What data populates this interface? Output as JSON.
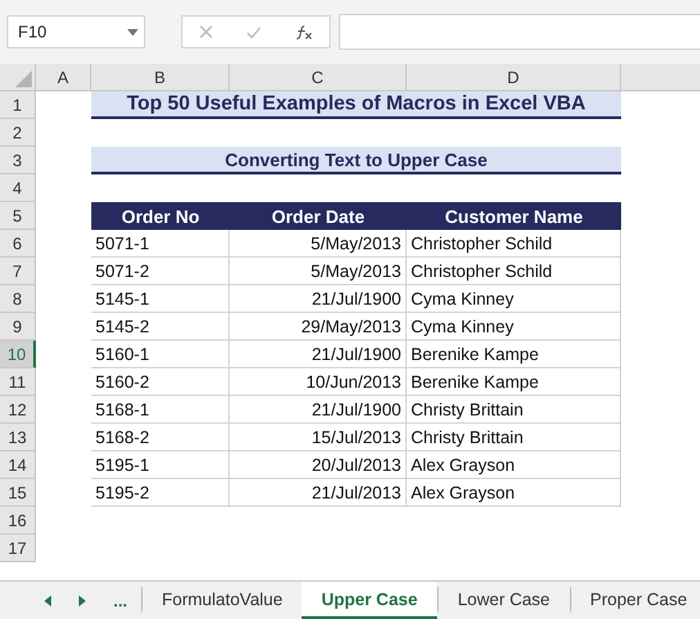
{
  "name_box": {
    "value": "F10"
  },
  "column_headers": [
    {
      "label": "A",
      "selected": false
    },
    {
      "label": "B",
      "selected": false
    },
    {
      "label": "C",
      "selected": false
    },
    {
      "label": "D",
      "selected": false
    }
  ],
  "row_headers": [
    {
      "label": "1",
      "selected": false
    },
    {
      "label": "2",
      "selected": false
    },
    {
      "label": "3",
      "selected": false
    },
    {
      "label": "4",
      "selected": false
    },
    {
      "label": "5",
      "selected": false
    },
    {
      "label": "6",
      "selected": false
    },
    {
      "label": "7",
      "selected": false
    },
    {
      "label": "8",
      "selected": false
    },
    {
      "label": "9",
      "selected": false
    },
    {
      "label": "10",
      "selected": true
    },
    {
      "label": "11",
      "selected": false
    },
    {
      "label": "12",
      "selected": false
    },
    {
      "label": "13",
      "selected": false
    },
    {
      "label": "14",
      "selected": false
    },
    {
      "label": "15",
      "selected": false
    },
    {
      "label": "16",
      "selected": false
    },
    {
      "label": "17",
      "selected": false
    }
  ],
  "title": "Top 50 Useful Examples of Macros in Excel VBA",
  "subtitle": "Converting Text to Upper Case",
  "table": {
    "columns": [
      "Order No",
      "Order Date",
      "Customer Name"
    ],
    "rows": [
      [
        "5071-1",
        "5/May/2013",
        "Christopher Schild"
      ],
      [
        "5071-2",
        "5/May/2013",
        "Christopher Schild"
      ],
      [
        "5145-1",
        "21/Jul/1900",
        "Cyma Kinney"
      ],
      [
        "5145-2",
        "29/May/2013",
        "Cyma Kinney"
      ],
      [
        "5160-1",
        "21/Jul/1900",
        "Berenike Kampe"
      ],
      [
        "5160-2",
        "10/Jun/2013",
        "Berenike Kampe"
      ],
      [
        "5168-1",
        "21/Jul/1900",
        "Christy Brittain"
      ],
      [
        "5168-2",
        "15/Jul/2013",
        "Christy Brittain"
      ],
      [
        "5195-1",
        "20/Jul/2013",
        "Alex Grayson"
      ],
      [
        "5195-2",
        "21/Jul/2013",
        "Alex Grayson"
      ]
    ]
  },
  "sheet_tabs": {
    "more": "...",
    "tabs": [
      {
        "label": "FormulatoValue",
        "selected": false
      },
      {
        "label": "Upper Case",
        "selected": true
      },
      {
        "label": "Lower Case",
        "selected": false
      },
      {
        "label": "Proper Case",
        "selected": false
      }
    ]
  }
}
